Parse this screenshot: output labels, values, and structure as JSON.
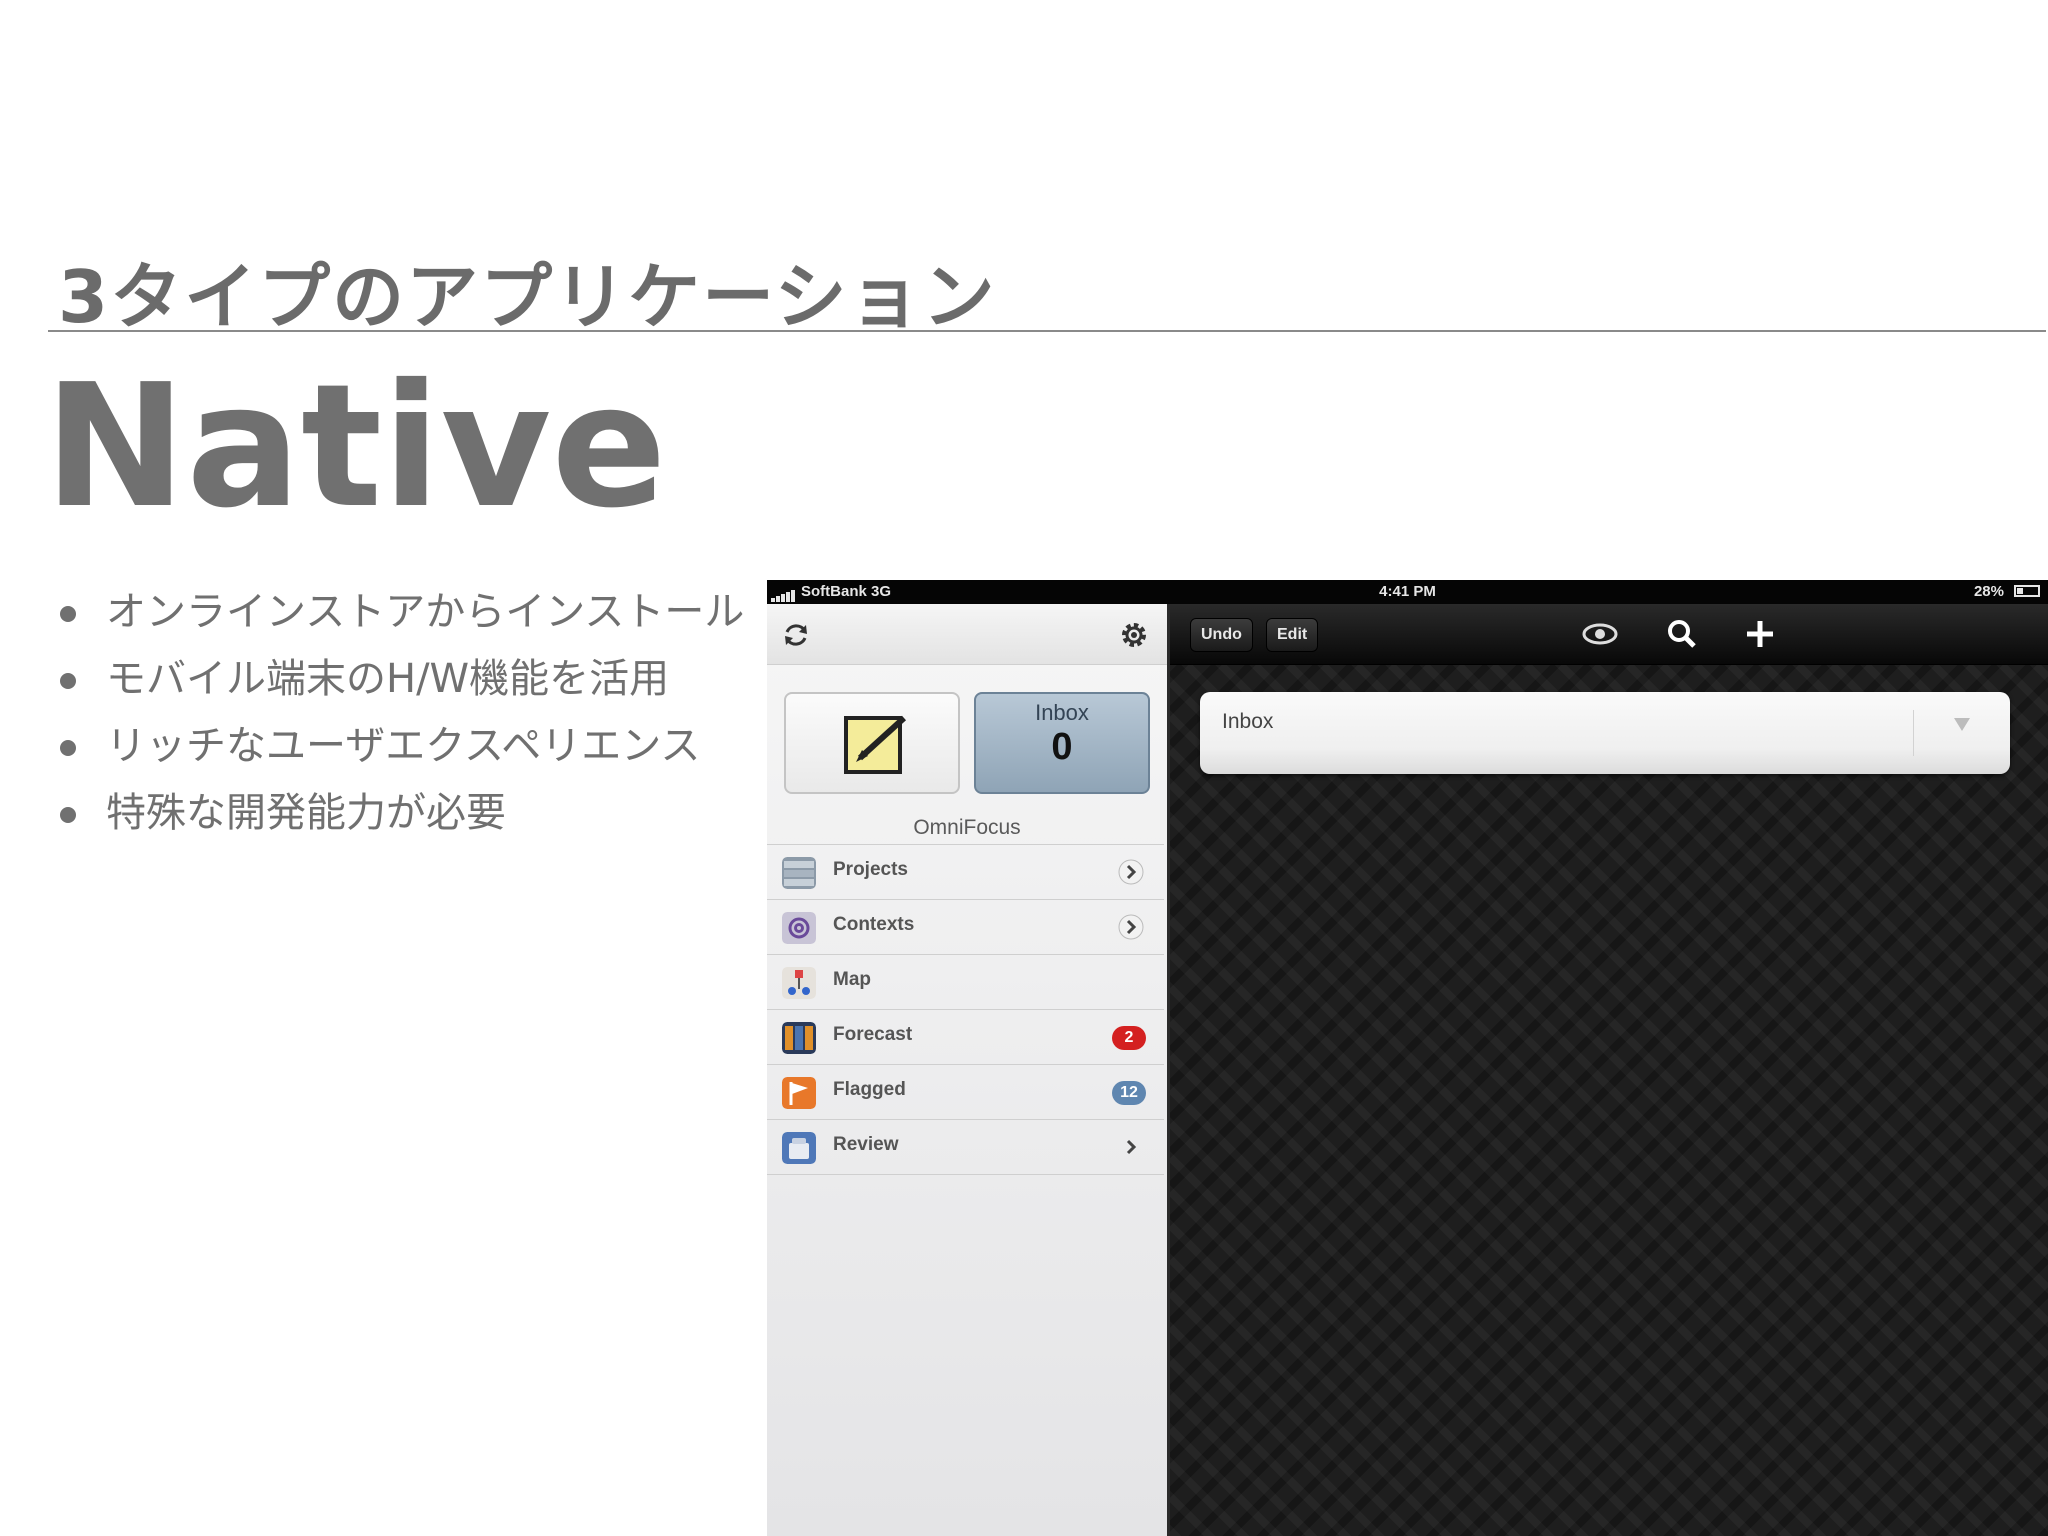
{
  "slide": {
    "subtitle": "3タイプのアプリケーション",
    "title": "Native",
    "bullets": [
      "オンラインストアからインストール",
      "モバイル端末のH/W機能を活用",
      "リッチなユーザエクスペリエンス",
      "特殊な開発能力が必要"
    ]
  },
  "device": {
    "status": {
      "carrier": "SoftBank 3G",
      "time": "4:41 PM",
      "battery": "28%"
    },
    "sidebar": {
      "inbox_tile": {
        "label": "Inbox",
        "count": "0"
      },
      "app_name": "OmniFocus",
      "items": [
        {
          "label": "Projects",
          "icon": "projects-icon"
        },
        {
          "label": "Contexts",
          "icon": "contexts-icon"
        },
        {
          "label": "Map",
          "icon": "map-icon"
        },
        {
          "label": "Forecast",
          "icon": "forecast-icon",
          "badge": "2",
          "badge_color": "#d42020"
        },
        {
          "label": "Flagged",
          "icon": "flagged-icon",
          "badge": "12",
          "badge_color": "#5f86b0"
        },
        {
          "label": "Review",
          "icon": "review-icon"
        }
      ]
    },
    "toolbar": {
      "undo_label": "Undo",
      "edit_label": "Edit"
    },
    "inbox_bar": {
      "label": "Inbox"
    }
  }
}
